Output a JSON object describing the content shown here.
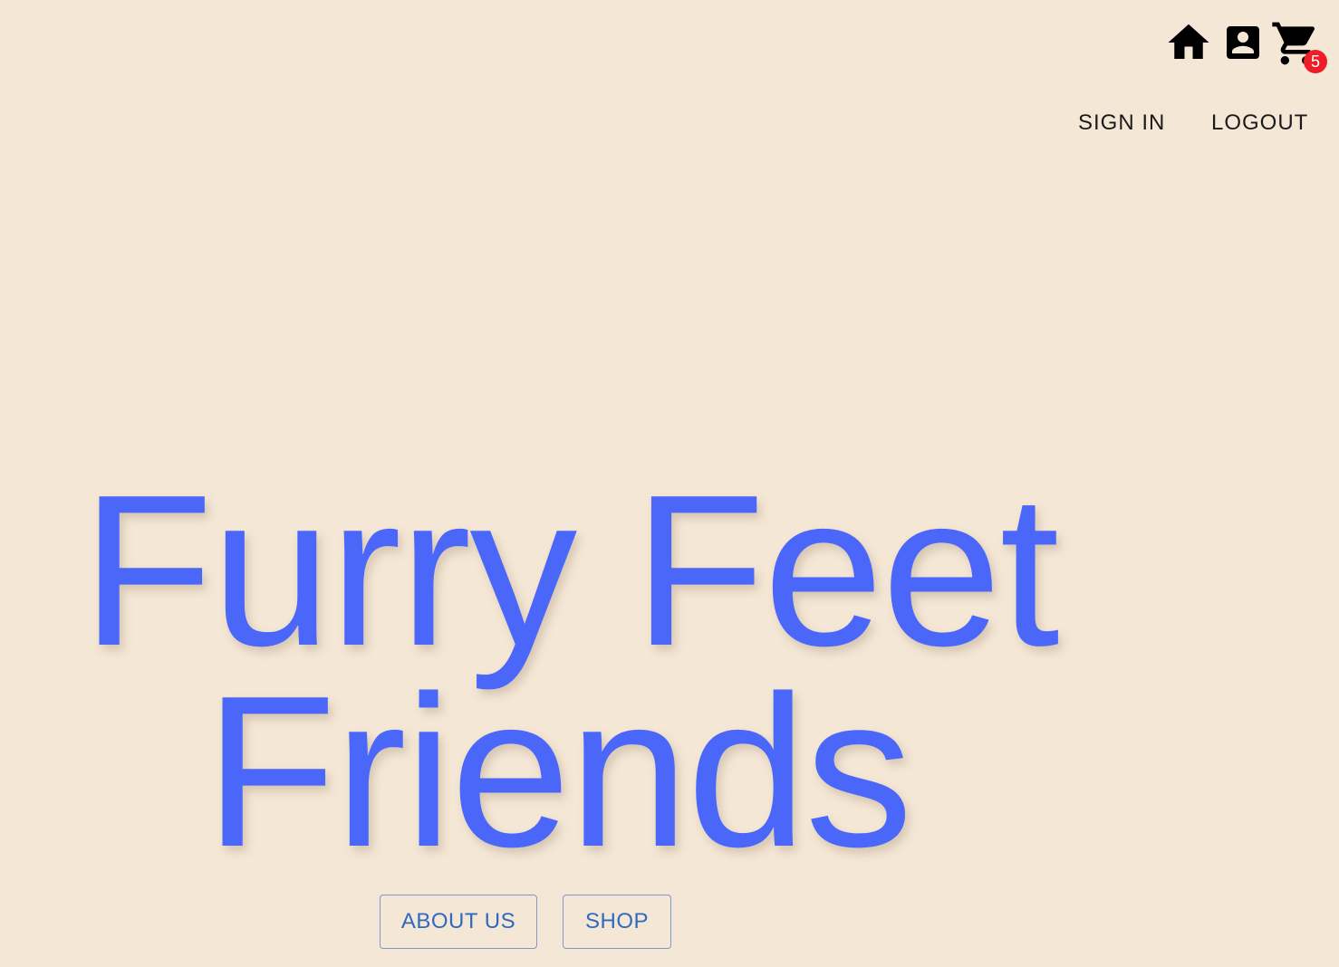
{
  "header": {
    "icons": [
      {
        "name": "home-icon"
      },
      {
        "name": "account-icon"
      },
      {
        "name": "cart-icon"
      }
    ],
    "cart_count": "5",
    "sign_in_label": "SIGN IN",
    "logout_label": "LOGOUT"
  },
  "hero": {
    "title_line1": "Furry Feet",
    "title_line2": "Friends"
  },
  "actions": {
    "about_label": "ABOUT US",
    "shop_label": "SHOP"
  },
  "colors": {
    "background": "#f5e7d5",
    "title": "#4a67fa",
    "badge": "#ee1e28",
    "button_text": "#2f6ac0"
  }
}
